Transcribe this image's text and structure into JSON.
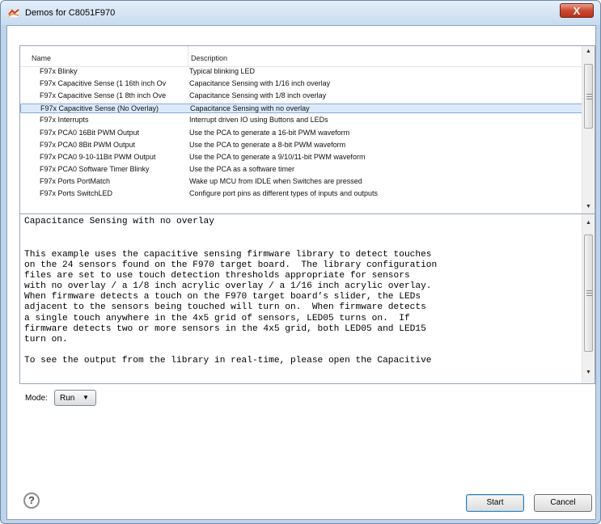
{
  "window": {
    "title": "Demos for C8051F970",
    "close_label": "X"
  },
  "list": {
    "columns": [
      "Name",
      "Description"
    ],
    "selected_index": 3,
    "rows": [
      {
        "name": "F97x Blinky",
        "description": "Typical blinking LED"
      },
      {
        "name": "F97x Capacitive Sense (1 16th inch Ov",
        "description": "Capacitance Sensing with 1/16 inch overlay"
      },
      {
        "name": "F97x Capacitive Sense (1 8th inch Ove",
        "description": "Capacitance Sensing with 1/8 inch overlay"
      },
      {
        "name": "F97x Capacitive Sense (No Overlay)",
        "description": "Capacitance Sensing with no overlay"
      },
      {
        "name": "F97x Interrupts",
        "description": "Interrupt driven IO using Buttons and LEDs"
      },
      {
        "name": "F97x PCA0 16Bit PWM Output",
        "description": "Use the PCA to generate a 16-bit PWM waveform"
      },
      {
        "name": "F97x PCA0 8Bit PWM Output",
        "description": "Use the PCA to generate a 8-bit PWM waveform"
      },
      {
        "name": "F97x PCA0 9-10-11Bit PWM Output",
        "description": "Use the PCA to generate a 9/10/11-bit PWM waveform"
      },
      {
        "name": "F97x PCA0 Software Timer Blinky",
        "description": "Use the PCA as a software timer"
      },
      {
        "name": "F97x Ports PortMatch",
        "description": "Wake up MCU from IDLE when Switches are pressed"
      },
      {
        "name": "F97x Ports SwitchLED",
        "description": "Configure port pins as different types of inputs and outputs"
      }
    ]
  },
  "details": {
    "title": "Capacitance Sensing with no overlay",
    "lines": [
      "This example uses the capacitive sensing firmware library to detect touches",
      "on the 24 sensors found on the F970 target board.  The library configuration",
      "files are set to use touch detection thresholds appropriate for sensors",
      "with no overlay / a 1/8 inch acrylic overlay / a 1/16 inch acrylic overlay.",
      "When firmware detects a touch on the F970 target board’s slider, the LEDs",
      "adjacent to the sensors being touched will turn on.  When firmware detects",
      "a single touch anywhere in the 4x5 grid of sensors, LED05 turns on.  If",
      "firmware detects two or more sensors in the 4x5 grid, both LED05 and LED15",
      "turn on.",
      "",
      "To see the output from the library in real-time, please open the Capacitive"
    ]
  },
  "mode": {
    "label": "Mode:",
    "value": "Run"
  },
  "buttons": {
    "help": "?",
    "start": "Start",
    "cancel": "Cancel"
  }
}
